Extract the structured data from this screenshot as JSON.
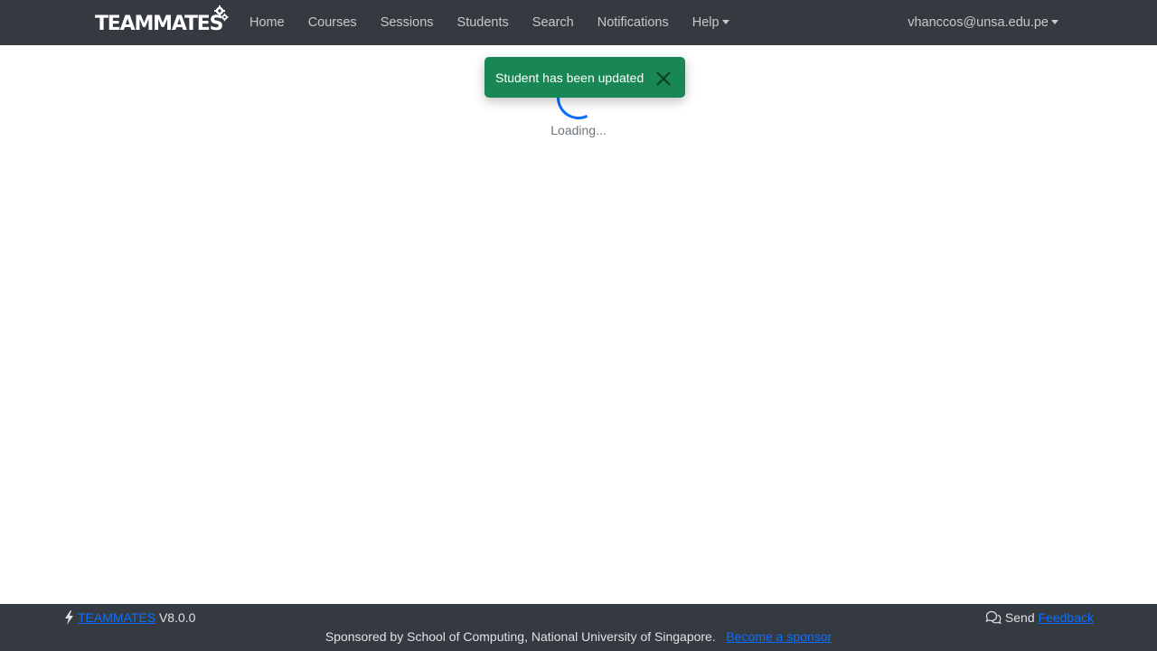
{
  "navbar": {
    "brand": "TEAMMATES",
    "links": [
      {
        "label": "Home"
      },
      {
        "label": "Courses"
      },
      {
        "label": "Sessions"
      },
      {
        "label": "Students"
      },
      {
        "label": "Search"
      },
      {
        "label": "Notifications"
      },
      {
        "label": "Help"
      }
    ],
    "user_email": "vhanccos@unsa.edu.pe"
  },
  "loading": {
    "text": "Loading..."
  },
  "toast": {
    "message": "Student has been updated",
    "color": "#198754"
  },
  "footer": {
    "product_link": "TEAMMATES",
    "version": "V8.0.0",
    "send_label": "Send",
    "feedback_link": "Feedback",
    "sponsor_text": "Sponsored by School of Computing, National University of Singapore.",
    "sponsor_link": "Become a sponsor"
  },
  "colors": {
    "navbar_bg": "#343a40",
    "link": "#0d6efd",
    "spinner": "#0d6efd"
  }
}
